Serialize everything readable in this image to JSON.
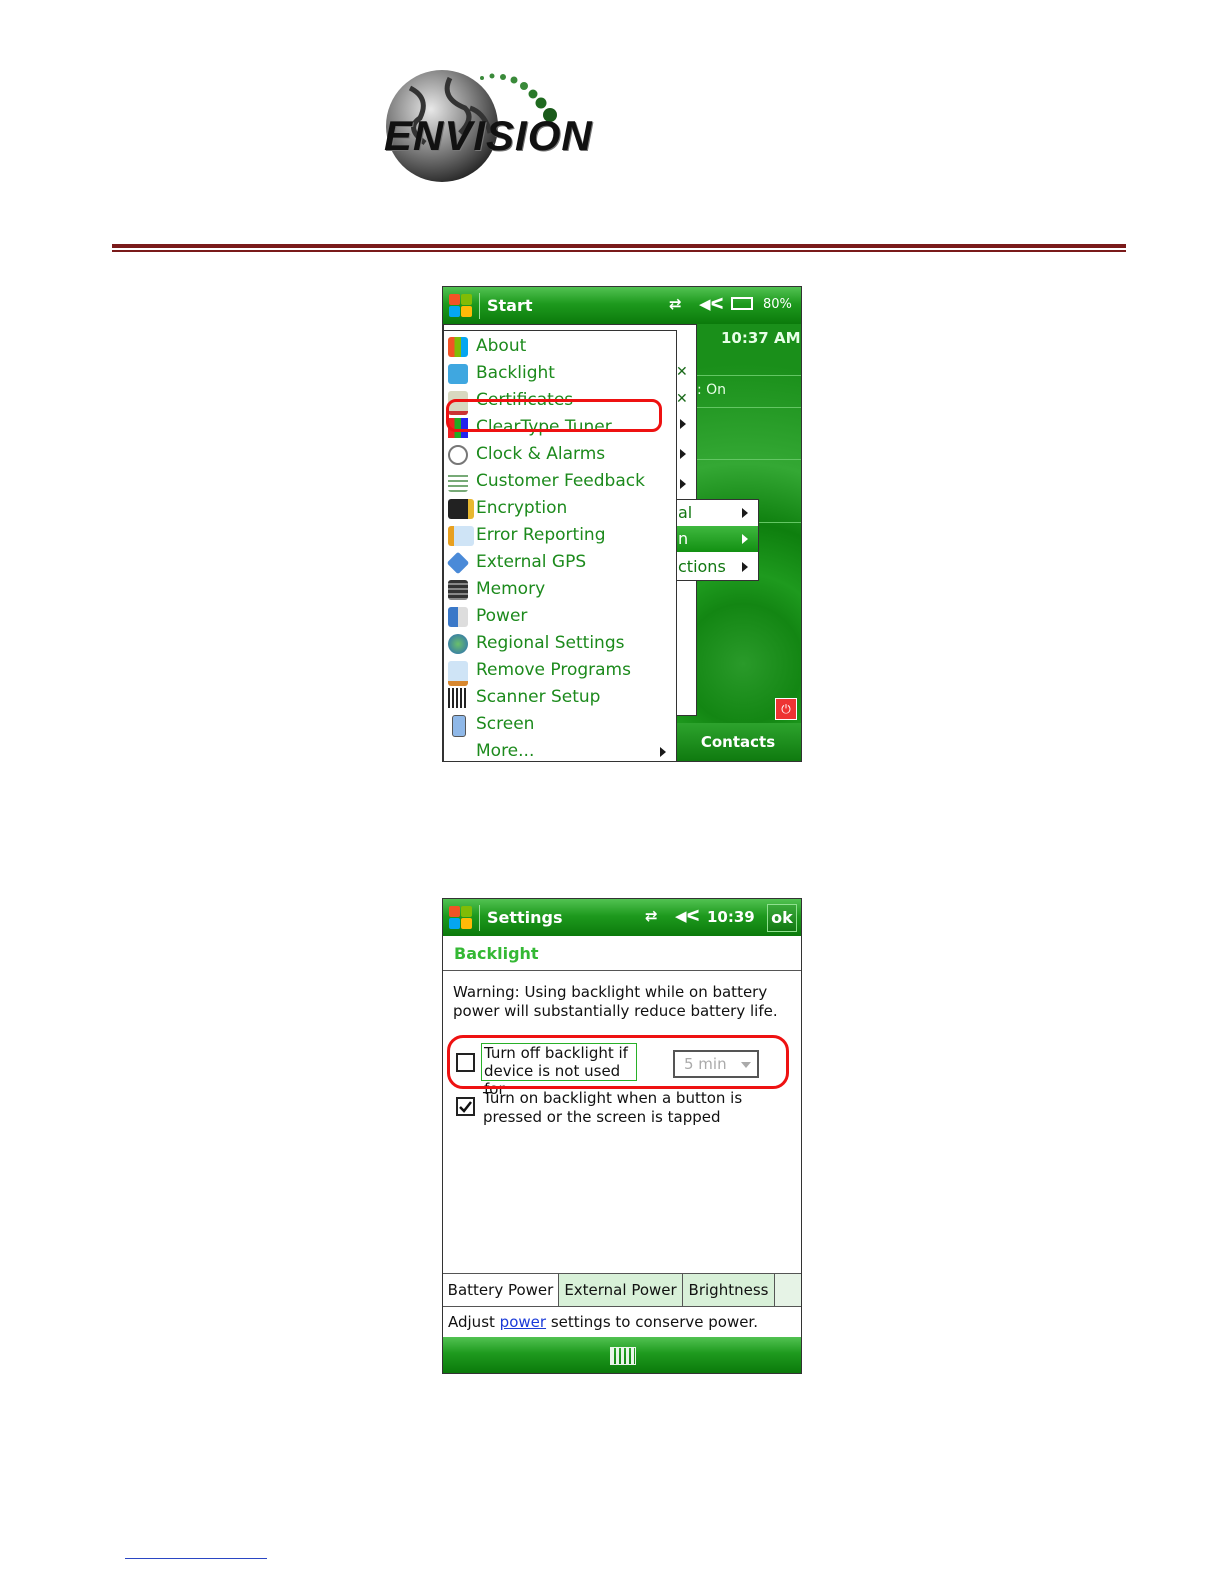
{
  "logo": {
    "text": "ENVISION"
  },
  "phone1": {
    "title": "Start",
    "battery": "80%",
    "time": "10:37 AM",
    "status_on": ": On",
    "contacts": "Contacts",
    "menu_items": [
      "About",
      "Backlight",
      "Certificates",
      "ClearType Tuner",
      "Clock & Alarms",
      "Customer Feedback",
      "Encryption",
      "Error Reporting",
      "External GPS",
      "Memory",
      "Power",
      "Regional Settings",
      "Remove Programs",
      "Scanner Setup",
      "Screen",
      "More..."
    ],
    "submenu_fragments": [
      "al",
      "n",
      "ctions"
    ]
  },
  "phone2": {
    "title": "Settings",
    "time": "10:39",
    "ok": "ok",
    "header": "Backlight",
    "warning": "Warning: Using backlight while on battery power will substantially reduce battery life.",
    "option1": "Turn off backlight if device is not used for",
    "option1_checked": false,
    "select_value": "5 min",
    "option2": "Turn on backlight when a button is pressed or the screen is tapped",
    "option2_checked": true,
    "tabs": [
      "Battery Power",
      "External Power",
      "Brightness"
    ],
    "footer_prefix": "Adjust ",
    "footer_link": "power",
    "footer_suffix": " settings to conserve power."
  },
  "colors": {
    "accent_green": "#1e9a1e",
    "highlight_red": "#e11111",
    "rule": "#7a1a1a"
  }
}
